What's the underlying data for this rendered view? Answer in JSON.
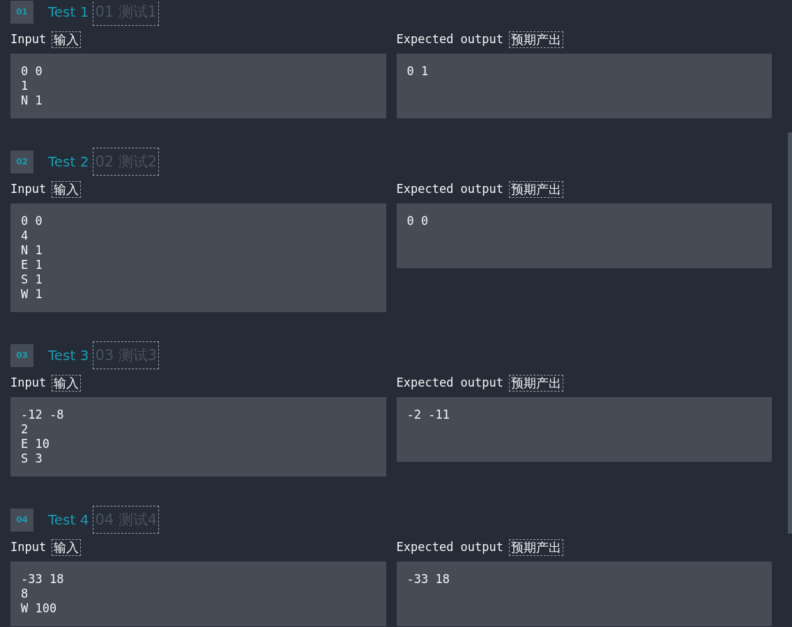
{
  "tests": [
    {
      "badge": "01",
      "title": "Test 1",
      "title_translation": "01 测试1",
      "input_label": "Input",
      "input_label_translation": "输入",
      "output_label": "Expected output",
      "output_label_translation": "预期产出",
      "input": [
        "0 0",
        "1",
        "N 1"
      ],
      "output": [
        "0 1"
      ]
    },
    {
      "badge": "02",
      "title": "Test 2",
      "title_translation": "02 测试2",
      "input_label": "Input",
      "input_label_translation": "输入",
      "output_label": "Expected output",
      "output_label_translation": "预期产出",
      "input": [
        "0 0",
        "4",
        "N 1",
        "E 1",
        "S 1",
        "W 1"
      ],
      "output": [
        "0 0"
      ]
    },
    {
      "badge": "03",
      "title": "Test 3",
      "title_translation": "03 测试3",
      "input_label": "Input",
      "input_label_translation": "输入",
      "output_label": "Expected output",
      "output_label_translation": "预期产出",
      "input": [
        "-12 -8",
        "2",
        "E 10",
        "S 3"
      ],
      "output": [
        "-2 -11"
      ]
    },
    {
      "badge": "04",
      "title": "Test 4",
      "title_translation": "04 测试4",
      "input_label": "Input",
      "input_label_translation": "输入",
      "output_label": "Expected output",
      "output_label_translation": "预期产出",
      "input": [
        "-33 18",
        "8",
        "W 100"
      ],
      "output": [
        "-33 18"
      ]
    }
  ]
}
